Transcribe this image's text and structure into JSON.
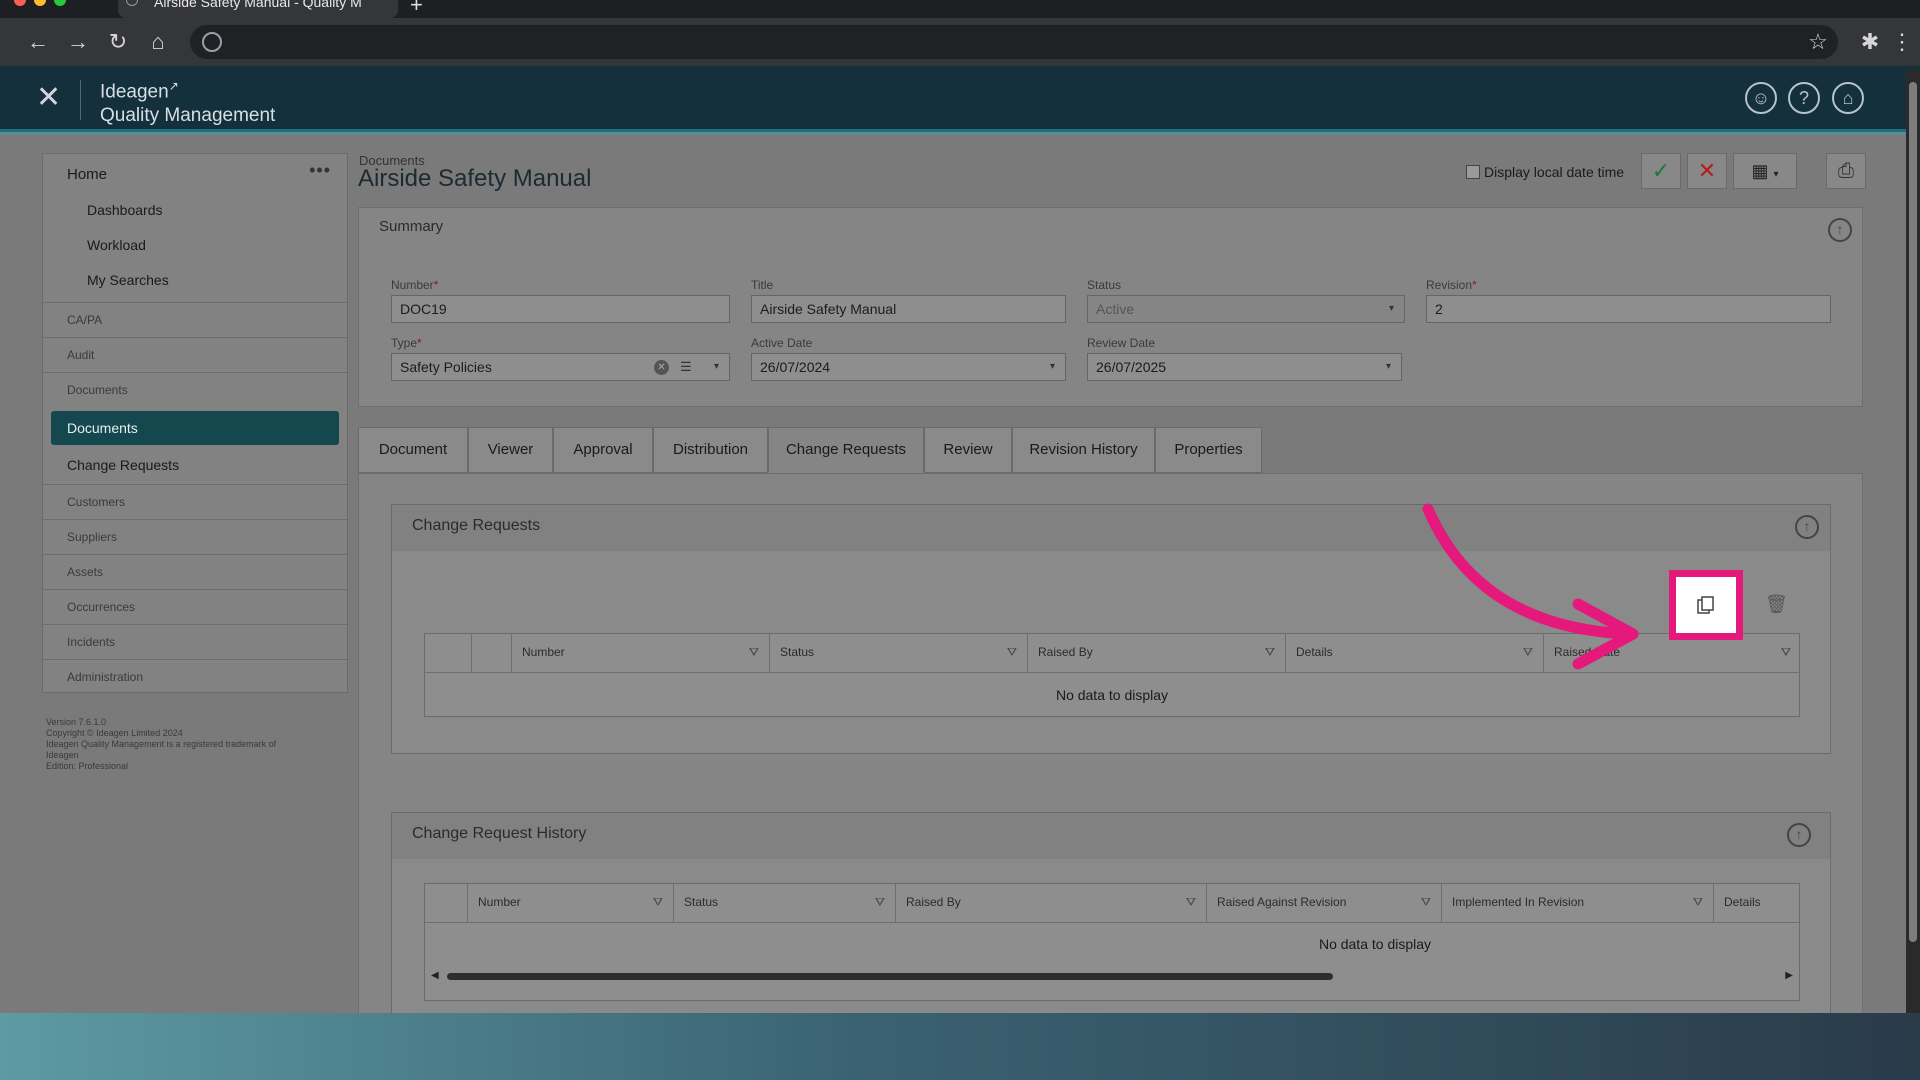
{
  "browser": {
    "tab_title": "Airside Safety Manual - Quality M",
    "new_tab": "+"
  },
  "app": {
    "brand_line1": "Ideagen",
    "brand_line2": "Quality Management"
  },
  "sidebar": {
    "home": "Home",
    "more": "•••",
    "home_items": [
      "Dashboards",
      "Workload",
      "My Searches"
    ],
    "sections": [
      "CA/PA",
      "Audit",
      "Documents"
    ],
    "doc_items": [
      "Documents",
      "Change Requests"
    ],
    "sections2": [
      "Customers",
      "Suppliers",
      "Assets",
      "Occurrences",
      "Incidents",
      "Administration"
    ],
    "footer": [
      "Version 7.6.1.0",
      "Copyright © Ideagen Limited 2024",
      "Ideagen Quality Management is a registered trademark of",
      "Ideagen",
      "Edition: Professional"
    ]
  },
  "page": {
    "breadcrumb": "Documents",
    "title": "Airside Safety Manual",
    "local_date_label": "Display local date time"
  },
  "summary": {
    "title": "Summary",
    "number_label": "Number",
    "number": "DOC19",
    "title_label": "Title",
    "title_value": "Airside Safety Manual",
    "status_label": "Status",
    "status": "Active",
    "revision_label": "Revision",
    "revision": "2",
    "type_label": "Type",
    "type": "Safety Policies",
    "active_date_label": "Active Date",
    "active_date": "26/07/2024",
    "review_date_label": "Review Date",
    "review_date": "26/07/2025"
  },
  "tabs": [
    "Document",
    "Viewer",
    "Approval",
    "Distribution",
    "Change Requests",
    "Review",
    "Revision History",
    "Properties"
  ],
  "change_requests": {
    "title": "Change Requests",
    "columns": [
      "Number",
      "Status",
      "Raised By",
      "Details",
      "Raised Date"
    ],
    "empty": "No data to display"
  },
  "history": {
    "title": "Change Request History",
    "columns": [
      "Number",
      "Status",
      "Raised By",
      "Raised Against Revision",
      "Implemented In Revision",
      "Details"
    ],
    "empty": "No data to display"
  },
  "colors": {
    "highlight": "#e5187c",
    "header": "#14303d",
    "active_nav": "#15474f"
  }
}
